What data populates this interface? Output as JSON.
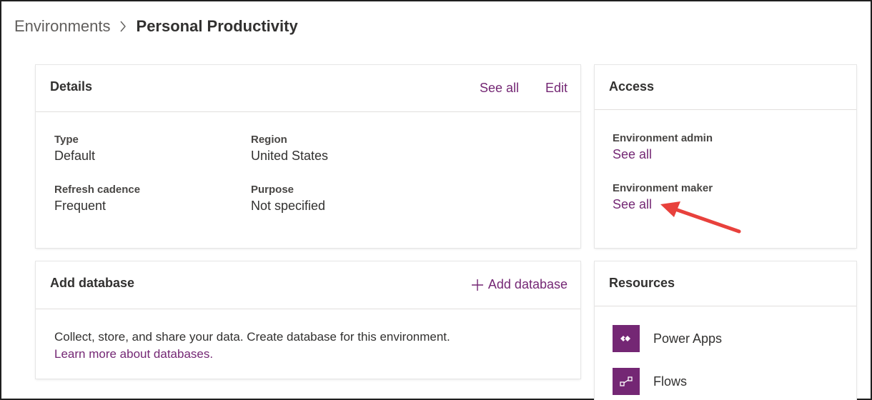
{
  "breadcrumb": {
    "parent": "Environments",
    "current": "Personal Productivity"
  },
  "details": {
    "title": "Details",
    "see_all": "See all",
    "edit": "Edit",
    "fields": [
      {
        "label": "Type",
        "value": "Default"
      },
      {
        "label": "Region",
        "value": "United States"
      },
      {
        "label": "Refresh cadence",
        "value": "Frequent"
      },
      {
        "label": "Purpose",
        "value": "Not specified"
      }
    ]
  },
  "access": {
    "title": "Access",
    "admin_label": "Environment admin",
    "admin_link": "See all",
    "maker_label": "Environment maker",
    "maker_link": "See all"
  },
  "add_database": {
    "title": "Add database",
    "button": "Add database",
    "description": "Collect, store, and share your data. Create database for this environment.",
    "learn_more": "Learn more about databases."
  },
  "resources": {
    "title": "Resources",
    "items": [
      {
        "label": "Power Apps",
        "icon": "power-apps-icon"
      },
      {
        "label": "Flows",
        "icon": "flows-icon"
      }
    ]
  },
  "colors": {
    "accent": "#742774",
    "annotation_arrow": "#e8413c"
  }
}
